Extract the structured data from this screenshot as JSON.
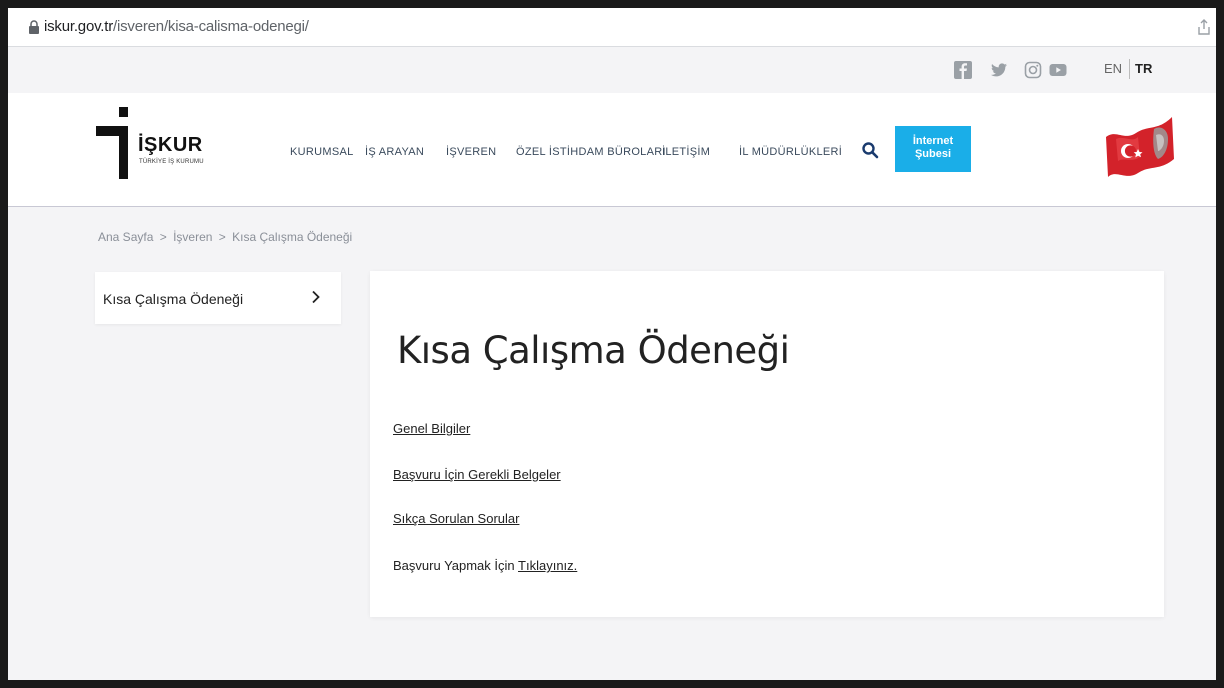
{
  "browser": {
    "url_domain": "iskur.gov.tr",
    "url_path": "/isveren/kisa-calisma-odenegi/",
    "lock_icon": "lock-icon",
    "share_icon": "share-icon"
  },
  "topbar": {
    "social_icons": [
      "facebook-icon",
      "twitter-icon",
      "instagram-icon",
      "youtube-icon"
    ],
    "lang_en": "EN",
    "lang_tr": "TR"
  },
  "header": {
    "logo_text": "İŞKUR",
    "logo_sub": "TÜRKİYE İŞ KURUMU",
    "nav": [
      "KURUMSAL",
      "İŞ ARAYAN",
      "İŞVEREN",
      "ÖZEL İSTİHDAM BÜROLARI",
      "İLETİŞİM",
      "İL MÜDÜRLÜKLERİ"
    ],
    "internet_line1": "İnternet",
    "internet_line2": "Şubesi",
    "flag_icon": "turkish-flag-icon",
    "accent_color": "#1aaee8"
  },
  "breadcrumb": {
    "items": [
      "Ana Sayfa",
      ">",
      "İşveren",
      ">",
      "Kısa Çalışma Ödeneği"
    ]
  },
  "sidebar": {
    "item_label": "Kısa Çalışma Ödeneği"
  },
  "main": {
    "title": "Kısa Çalışma Ödeneği",
    "links": [
      "Genel Bilgiler",
      "Başvuru İçin Gerekli Belgeler",
      "Sıkça Sorulan Sorular"
    ],
    "apply_text": "Başvuru Yapmak İçin",
    "apply_link": "Tıklayınız."
  }
}
